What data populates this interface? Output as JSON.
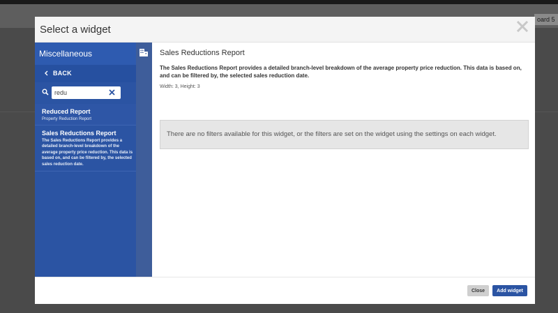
{
  "background": {
    "tab_text": "oard 5"
  },
  "modal": {
    "title": "Select a widget",
    "close_icon": "close-icon"
  },
  "sidebar": {
    "category": "Miscellaneous",
    "category_icon": "building-icon",
    "back_label": "BACK",
    "search": {
      "value": "redu",
      "icon": "search-icon",
      "clear_icon": "clear-icon"
    },
    "results": [
      {
        "title": "Reduced Report",
        "description": "Property Reduction Report"
      },
      {
        "title": "Sales Reductions Report",
        "description": "The Sales Reductions Report provides a detailed branch-level breakdown of the average property price reduction. This data is based on, and can be filtered by, the selected sales reduction date."
      }
    ]
  },
  "main": {
    "title": "Sales Reductions Report",
    "description": "The Sales Reductions Report provides a detailed branch-level breakdown of the average property price reduction. This data is based on, and can be filtered by, the selected sales reduction date.",
    "dimensions": "Width: 3, Height: 3",
    "filters_message": "There are no filters available for this widget, or the filters are set on the widget using the settings on each widget."
  },
  "footer": {
    "close_label": "Close",
    "add_label": "Add widget"
  },
  "colors": {
    "accent": "#2b54a3",
    "sidebar_strip": "#3e5d9a",
    "overlay": "#4a4a4a"
  }
}
